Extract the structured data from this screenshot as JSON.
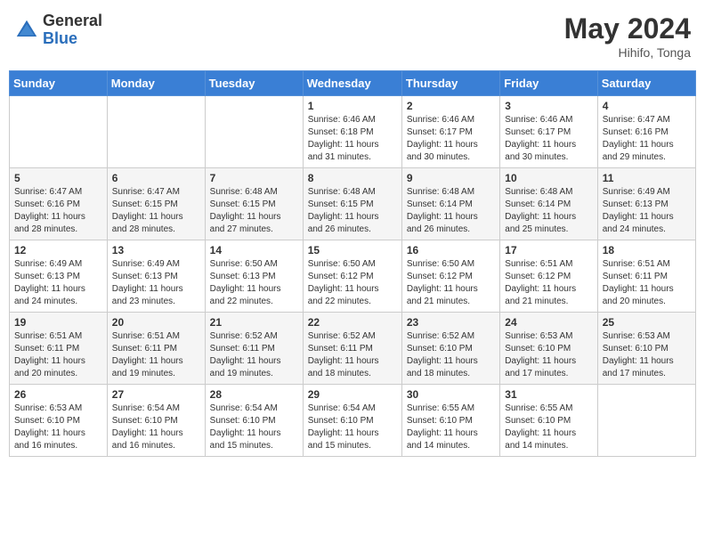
{
  "header": {
    "logo_general": "General",
    "logo_blue": "Blue",
    "month_year": "May 2024",
    "location": "Hihifo, Tonga"
  },
  "weekdays": [
    "Sunday",
    "Monday",
    "Tuesday",
    "Wednesday",
    "Thursday",
    "Friday",
    "Saturday"
  ],
  "weeks": [
    [
      {
        "day": "",
        "info": ""
      },
      {
        "day": "",
        "info": ""
      },
      {
        "day": "",
        "info": ""
      },
      {
        "day": "1",
        "info": "Sunrise: 6:46 AM\nSunset: 6:18 PM\nDaylight: 11 hours\nand 31 minutes."
      },
      {
        "day": "2",
        "info": "Sunrise: 6:46 AM\nSunset: 6:17 PM\nDaylight: 11 hours\nand 30 minutes."
      },
      {
        "day": "3",
        "info": "Sunrise: 6:46 AM\nSunset: 6:17 PM\nDaylight: 11 hours\nand 30 minutes."
      },
      {
        "day": "4",
        "info": "Sunrise: 6:47 AM\nSunset: 6:16 PM\nDaylight: 11 hours\nand 29 minutes."
      }
    ],
    [
      {
        "day": "5",
        "info": "Sunrise: 6:47 AM\nSunset: 6:16 PM\nDaylight: 11 hours\nand 28 minutes."
      },
      {
        "day": "6",
        "info": "Sunrise: 6:47 AM\nSunset: 6:15 PM\nDaylight: 11 hours\nand 28 minutes."
      },
      {
        "day": "7",
        "info": "Sunrise: 6:48 AM\nSunset: 6:15 PM\nDaylight: 11 hours\nand 27 minutes."
      },
      {
        "day": "8",
        "info": "Sunrise: 6:48 AM\nSunset: 6:15 PM\nDaylight: 11 hours\nand 26 minutes."
      },
      {
        "day": "9",
        "info": "Sunrise: 6:48 AM\nSunset: 6:14 PM\nDaylight: 11 hours\nand 26 minutes."
      },
      {
        "day": "10",
        "info": "Sunrise: 6:48 AM\nSunset: 6:14 PM\nDaylight: 11 hours\nand 25 minutes."
      },
      {
        "day": "11",
        "info": "Sunrise: 6:49 AM\nSunset: 6:13 PM\nDaylight: 11 hours\nand 24 minutes."
      }
    ],
    [
      {
        "day": "12",
        "info": "Sunrise: 6:49 AM\nSunset: 6:13 PM\nDaylight: 11 hours\nand 24 minutes."
      },
      {
        "day": "13",
        "info": "Sunrise: 6:49 AM\nSunset: 6:13 PM\nDaylight: 11 hours\nand 23 minutes."
      },
      {
        "day": "14",
        "info": "Sunrise: 6:50 AM\nSunset: 6:13 PM\nDaylight: 11 hours\nand 22 minutes."
      },
      {
        "day": "15",
        "info": "Sunrise: 6:50 AM\nSunset: 6:12 PM\nDaylight: 11 hours\nand 22 minutes."
      },
      {
        "day": "16",
        "info": "Sunrise: 6:50 AM\nSunset: 6:12 PM\nDaylight: 11 hours\nand 21 minutes."
      },
      {
        "day": "17",
        "info": "Sunrise: 6:51 AM\nSunset: 6:12 PM\nDaylight: 11 hours\nand 21 minutes."
      },
      {
        "day": "18",
        "info": "Sunrise: 6:51 AM\nSunset: 6:11 PM\nDaylight: 11 hours\nand 20 minutes."
      }
    ],
    [
      {
        "day": "19",
        "info": "Sunrise: 6:51 AM\nSunset: 6:11 PM\nDaylight: 11 hours\nand 20 minutes."
      },
      {
        "day": "20",
        "info": "Sunrise: 6:51 AM\nSunset: 6:11 PM\nDaylight: 11 hours\nand 19 minutes."
      },
      {
        "day": "21",
        "info": "Sunrise: 6:52 AM\nSunset: 6:11 PM\nDaylight: 11 hours\nand 19 minutes."
      },
      {
        "day": "22",
        "info": "Sunrise: 6:52 AM\nSunset: 6:11 PM\nDaylight: 11 hours\nand 18 minutes."
      },
      {
        "day": "23",
        "info": "Sunrise: 6:52 AM\nSunset: 6:10 PM\nDaylight: 11 hours\nand 18 minutes."
      },
      {
        "day": "24",
        "info": "Sunrise: 6:53 AM\nSunset: 6:10 PM\nDaylight: 11 hours\nand 17 minutes."
      },
      {
        "day": "25",
        "info": "Sunrise: 6:53 AM\nSunset: 6:10 PM\nDaylight: 11 hours\nand 17 minutes."
      }
    ],
    [
      {
        "day": "26",
        "info": "Sunrise: 6:53 AM\nSunset: 6:10 PM\nDaylight: 11 hours\nand 16 minutes."
      },
      {
        "day": "27",
        "info": "Sunrise: 6:54 AM\nSunset: 6:10 PM\nDaylight: 11 hours\nand 16 minutes."
      },
      {
        "day": "28",
        "info": "Sunrise: 6:54 AM\nSunset: 6:10 PM\nDaylight: 11 hours\nand 15 minutes."
      },
      {
        "day": "29",
        "info": "Sunrise: 6:54 AM\nSunset: 6:10 PM\nDaylight: 11 hours\nand 15 minutes."
      },
      {
        "day": "30",
        "info": "Sunrise: 6:55 AM\nSunset: 6:10 PM\nDaylight: 11 hours\nand 14 minutes."
      },
      {
        "day": "31",
        "info": "Sunrise: 6:55 AM\nSunset: 6:10 PM\nDaylight: 11 hours\nand 14 minutes."
      },
      {
        "day": "",
        "info": ""
      }
    ]
  ]
}
